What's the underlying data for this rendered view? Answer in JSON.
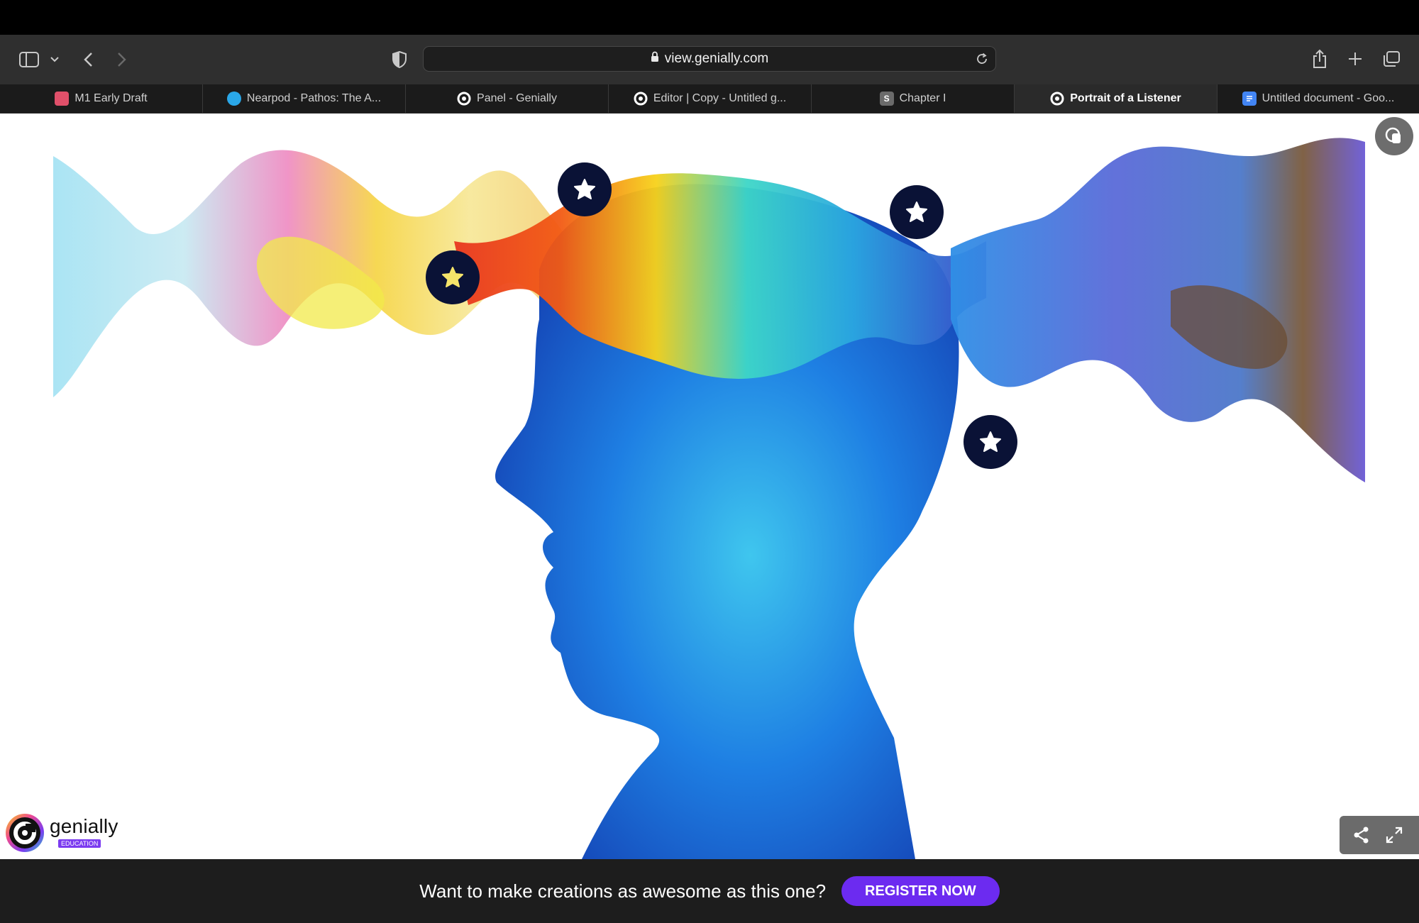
{
  "browser": {
    "url": "view.genially.com",
    "tabs": [
      {
        "label": "M1 Early Draft",
        "icon": "draft-favicon",
        "color": "#e0506a",
        "letter": "",
        "active": false
      },
      {
        "label": "Nearpod - Pathos: The A...",
        "icon": "nearpod-favicon",
        "color": "#2aa7e8",
        "letter": "",
        "active": false
      },
      {
        "label": "Panel - Genially",
        "icon": "genially-favicon",
        "color": "#ffffff",
        "letter": "",
        "active": false
      },
      {
        "label": "Editor | Copy - Untitled g...",
        "icon": "genially-favicon",
        "color": "#ffffff",
        "letter": "",
        "active": false
      },
      {
        "label": "Chapter I",
        "icon": "s-favicon",
        "color": "#6b6b6b",
        "letter": "S",
        "active": false
      },
      {
        "label": "Portrait of a Listener",
        "icon": "genially-favicon",
        "color": "#ffffff",
        "letter": "",
        "active": true
      },
      {
        "label": "Untitled document - Goo...",
        "icon": "google-docs-favicon",
        "color": "#4285f4",
        "letter": "",
        "active": false
      }
    ]
  },
  "genially": {
    "brand": "genially",
    "badge": "EDUCATION"
  },
  "banner": {
    "text": "Want to make creations as awesome as this one?",
    "button": "REGISTER NOW"
  },
  "colors": {
    "hotspot": "#0a1236",
    "register_button": "#6c2bf0"
  }
}
